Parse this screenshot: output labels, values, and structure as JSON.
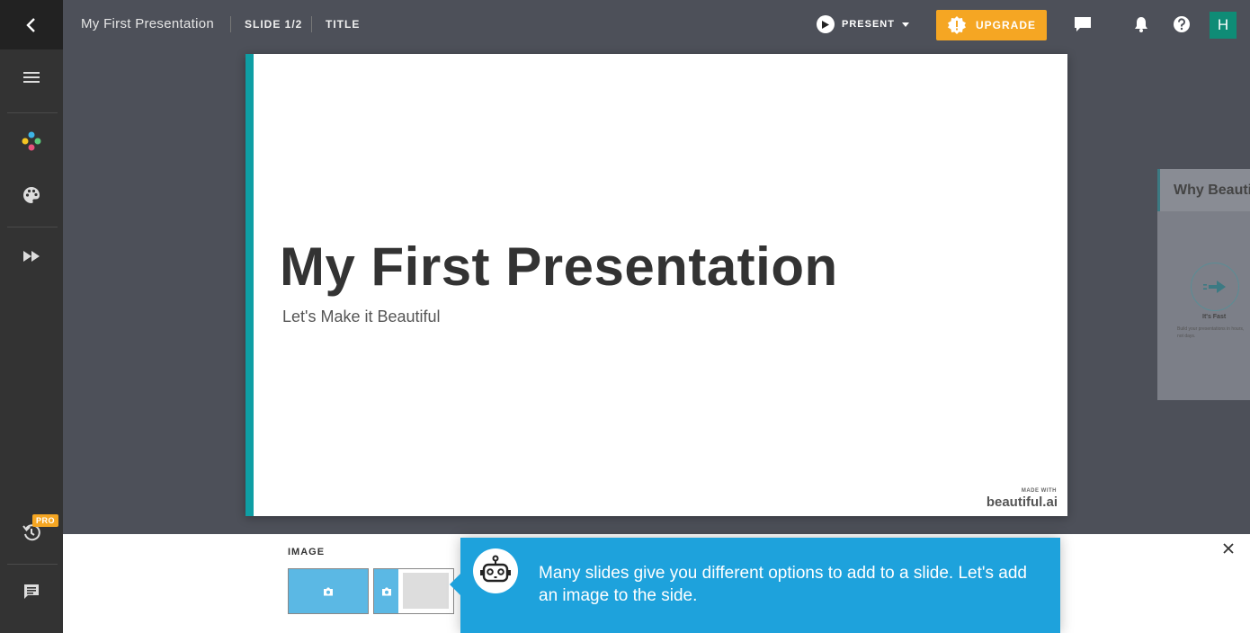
{
  "topbar": {
    "title": "My First Presentation",
    "slide_label": "SLIDE 1/2",
    "layout_label": "TITLE",
    "present_label": "PRESENT",
    "upgrade_label": "UPGRADE",
    "avatar_initial": "H"
  },
  "sidebar": {
    "pro_badge": "PRO"
  },
  "slide": {
    "title": "My First Presentation",
    "subtitle": "Let's Make it Beautiful",
    "made_with": "MADE WITH",
    "logo_text": "beautiful.ai",
    "accent_color": "#0e9ea4"
  },
  "next_slide": {
    "title": "Why Beautiful.ai",
    "caption": "It's Fast",
    "small_text": "Build your presentations in hours, not days."
  },
  "bottom_panel": {
    "section_label": "IMAGE"
  },
  "tooltip": {
    "text": "Many slides give you different options to add to a slide. Let's add an image to the side."
  },
  "colors": {
    "upgrade": "#f5a623",
    "tooltip": "#1ea2dc",
    "avatar": "#0f8c76"
  }
}
